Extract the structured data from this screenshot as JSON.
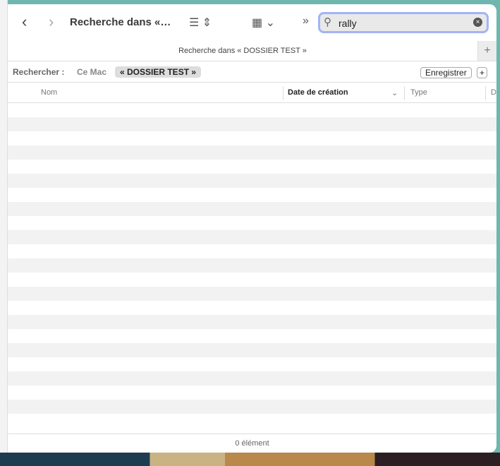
{
  "toolbar": {
    "back": "‹",
    "forward": "›",
    "title": "Recherche dans «…",
    "list_view_icon": "list-icon",
    "group_icon": "grid-icon",
    "overflow": "»",
    "search_value": "rally",
    "search_icon": "magnifier-icon",
    "clear": "×"
  },
  "tab": {
    "title": "Recherche dans « DOSSIER TEST »",
    "plus": "+"
  },
  "scope": {
    "label": "Rechercher :",
    "this_mac": "Ce Mac",
    "folder": "« DOSSIER TEST »",
    "save": "Enregistrer",
    "add": "+"
  },
  "columns": {
    "name": "Nom",
    "date": "Date de création",
    "type": "Type",
    "d": "D"
  },
  "status": "0 élément"
}
